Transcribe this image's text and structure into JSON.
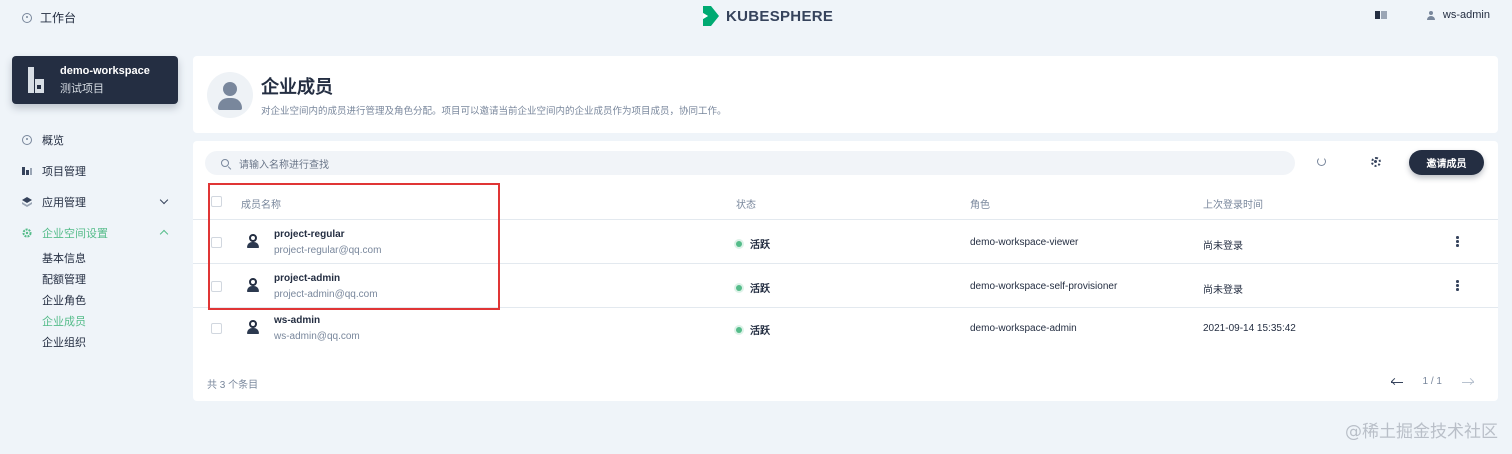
{
  "topbar": {
    "workbench_label": "工作台",
    "brand": "KUBESPHERE",
    "user_name": "ws-admin"
  },
  "workspace": {
    "name": "demo-workspace",
    "description": "测试项目"
  },
  "sidebar": {
    "items": [
      {
        "label": "概览"
      },
      {
        "label": "项目管理"
      },
      {
        "label": "应用管理"
      },
      {
        "label": "企业空间设置"
      }
    ],
    "sub_items": [
      {
        "label": "基本信息"
      },
      {
        "label": "配额管理"
      },
      {
        "label": "企业角色"
      },
      {
        "label": "企业成员"
      },
      {
        "label": "企业组织"
      }
    ]
  },
  "header": {
    "title": "企业成员",
    "description": "对企业空间内的成员进行管理及角色分配。项目可以邀请当前企业空间内的企业成员作为项目成员，协同工作。"
  },
  "toolbar": {
    "search_placeholder": "请输入名称进行查找",
    "invite_label": "邀请成员"
  },
  "table": {
    "columns": {
      "name": "成员名称",
      "status": "状态",
      "role": "角色",
      "last_login": "上次登录时间"
    },
    "rows": [
      {
        "name": "project-regular",
        "email": "project-regular@qq.com",
        "status": "活跃",
        "role": "demo-workspace-viewer",
        "last_login": "尚未登录"
      },
      {
        "name": "project-admin",
        "email": "project-admin@qq.com",
        "status": "活跃",
        "role": "demo-workspace-self-provisioner",
        "last_login": "尚未登录"
      },
      {
        "name": "ws-admin",
        "email": "ws-admin@qq.com",
        "status": "活跃",
        "role": "demo-workspace-admin",
        "last_login": "2021-09-14 15:35:42"
      }
    ],
    "total": "共 3 个条目",
    "page": "1 / 1"
  },
  "watermark": "@稀土掘金技术社区",
  "colors": {
    "accent": "#55bc8a",
    "dark": "#242e42",
    "highlight": "#e03535"
  }
}
